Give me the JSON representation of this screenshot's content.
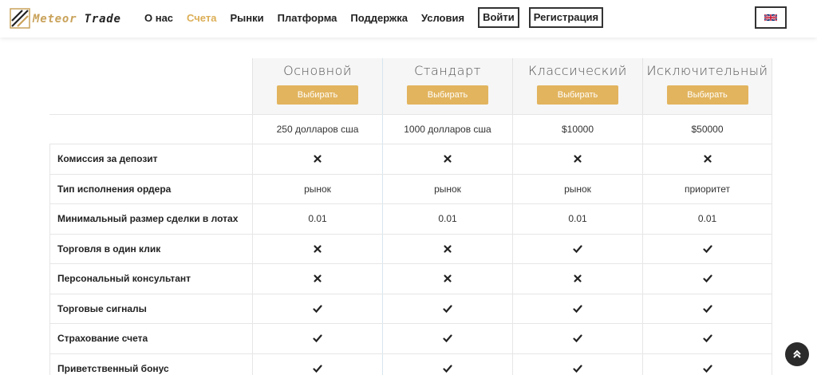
{
  "header": {
    "logo": {
      "word1": "Meteor",
      "word2": "Trade"
    },
    "nav": [
      {
        "label": "О нас",
        "active": false
      },
      {
        "label": "Счета",
        "active": true
      },
      {
        "label": "Рынки",
        "active": false
      },
      {
        "label": "Платформа",
        "active": false
      },
      {
        "label": "Поддержка",
        "active": false
      },
      {
        "label": "Условия",
        "active": false
      }
    ],
    "login_label": "Войти",
    "register_label": "Регистрация",
    "language": "flag-uk-icon"
  },
  "plans": [
    {
      "name": "Основной",
      "button": "Выбирать",
      "price": "250 долларов сша"
    },
    {
      "name": "Стандарт",
      "button": "Выбирать",
      "price": "1000 долларов сша"
    },
    {
      "name": "Классический",
      "button": "Выбирать",
      "price": "$10000"
    },
    {
      "name": "Исключительный",
      "button": "Выбирать",
      "price": "$50000"
    }
  ],
  "features": [
    {
      "label": "Комиссия за депозит",
      "values": [
        "cross",
        "cross",
        "cross",
        "cross"
      ]
    },
    {
      "label": "Тип исполнения ордера",
      "values": [
        "рынок",
        "рынок",
        "рынок",
        "приоритет"
      ]
    },
    {
      "label": "Минимальный размер сделки в лотах",
      "values": [
        "0.01",
        "0.01",
        "0.01",
        "0.01"
      ]
    },
    {
      "label": "Торговля в один клик",
      "values": [
        "cross",
        "cross",
        "check",
        "check"
      ]
    },
    {
      "label": "Персональный консультант",
      "values": [
        "cross",
        "cross",
        "cross",
        "check"
      ]
    },
    {
      "label": "Торговые сигналы",
      "values": [
        "check",
        "check",
        "check",
        "check"
      ]
    },
    {
      "label": "Страхование счета",
      "values": [
        "check",
        "check",
        "check",
        "check"
      ]
    },
    {
      "label": "Приветственный бонус",
      "values": [
        "check",
        "check",
        "check",
        "check"
      ]
    }
  ],
  "colors": {
    "accent": "#dcae56",
    "button": "#e2b45e",
    "text": "#222222"
  }
}
